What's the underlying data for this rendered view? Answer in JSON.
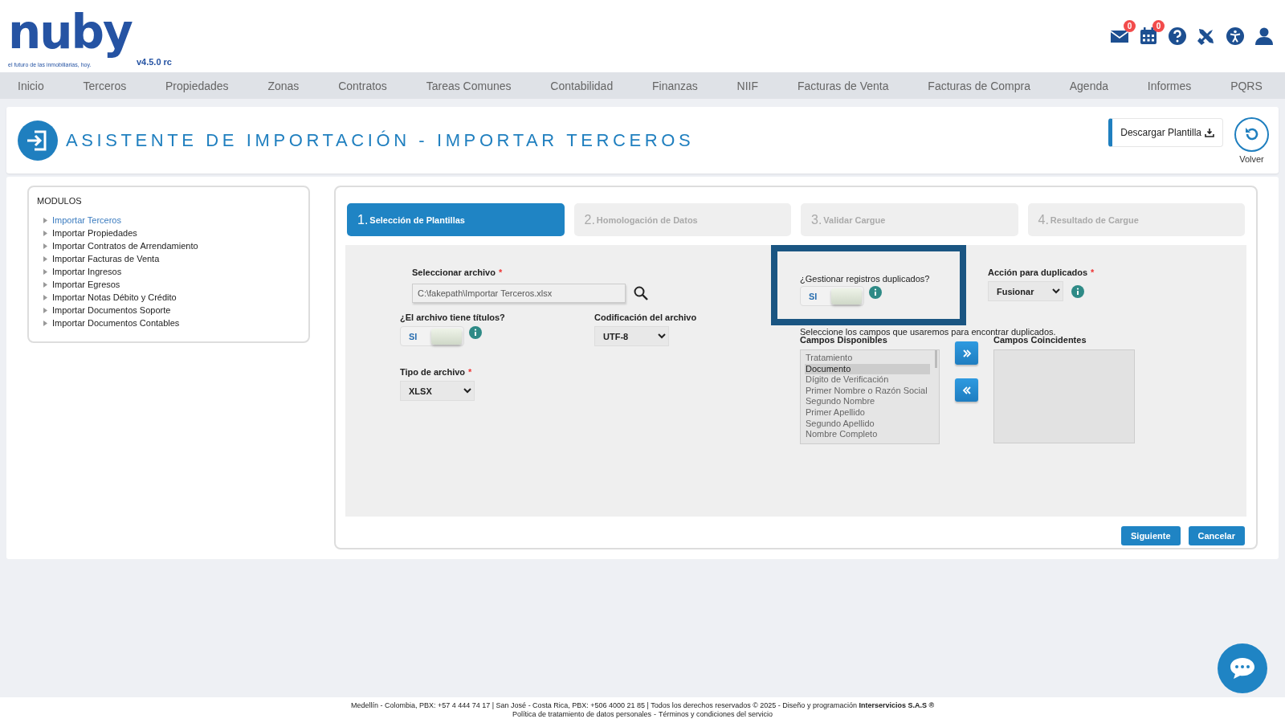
{
  "header": {
    "logo": "nuby",
    "tagline": "el futuro de las inmobiliarias, hoy.",
    "version": "v4.5.0 rc",
    "icons": [
      {
        "kind": "mail",
        "badge": "0"
      },
      {
        "kind": "calendar",
        "badge": "0"
      },
      {
        "kind": "help"
      },
      {
        "kind": "tools"
      },
      {
        "kind": "accessibility"
      },
      {
        "kind": "user"
      }
    ]
  },
  "nav": [
    "Inicio",
    "Terceros",
    "Propiedades",
    "Zonas",
    "Contratos",
    "Tareas Comunes",
    "Contabilidad",
    "Finanzas",
    "NIIF",
    "Facturas de Venta",
    "Facturas de Compra",
    "Agenda",
    "Informes",
    "PQRS"
  ],
  "page": {
    "title": "ASISTENTE DE IMPORTACIÓN - IMPORTAR TERCEROS",
    "download_button": "Descargar Plantilla",
    "back_label": "Volver"
  },
  "sidebar": {
    "title": "MODULOS",
    "items": [
      {
        "label": "Importar Terceros",
        "selected": true
      },
      {
        "label": "Importar Propiedades",
        "selected": false
      },
      {
        "label": "Importar Contratos de Arrendamiento",
        "selected": false
      },
      {
        "label": "Importar Facturas de Venta",
        "selected": false
      },
      {
        "label": "Importar Ingresos",
        "selected": false
      },
      {
        "label": "Importar Egresos",
        "selected": false
      },
      {
        "label": "Importar Notas Débito y Crédito",
        "selected": false
      },
      {
        "label": "Importar Documentos Soporte",
        "selected": false
      },
      {
        "label": "Importar Documentos Contables",
        "selected": false
      }
    ]
  },
  "steps": [
    {
      "number": "1.",
      "label": "Selección de Plantillas",
      "selected": true
    },
    {
      "number": "2.",
      "label": "Homologación de Datos",
      "selected": false
    },
    {
      "number": "3.",
      "label": "Validar Cargue",
      "selected": false
    },
    {
      "number": "4.",
      "label": "Resultado de Cargue",
      "selected": false
    }
  ],
  "form": {
    "file_label": "Seleccionar archivo",
    "file_value": "C:\\fakepath\\Importar Terceros.xlsx",
    "titles_label": "¿El archivo tiene títulos?",
    "titles_toggle": {
      "text": "SI",
      "on": true
    },
    "encoding_label": "Codificación del archivo",
    "encoding_value": "UTF-8",
    "type_label": "Tipo de archivo",
    "type_value": "XLSX",
    "required_mark": "*",
    "duplicates_label": "¿Gestionar registros duplicados?",
    "duplicates_toggle": {
      "text": "SI",
      "on": true
    },
    "action_label": "Acción para duplicados",
    "action_value": "Fusionar",
    "fields_hint": "Seleccione los campos que usaremos para encontrar duplicados.",
    "available_label": "Campos Disponibles",
    "matching_label": "Campos Coincidentes",
    "available_fields": [
      {
        "label": "Tratamiento",
        "selected": false
      },
      {
        "label": "Documento",
        "selected": true
      },
      {
        "label": "Dígito de Verificación",
        "selected": false
      },
      {
        "label": "Primer Nombre o Razón Social",
        "selected": false
      },
      {
        "label": "Segundo Nombre",
        "selected": false
      },
      {
        "label": "Primer Apellido",
        "selected": false
      },
      {
        "label": "Segundo Apellido",
        "selected": false
      },
      {
        "label": "Nombre Completo",
        "selected": false
      }
    ]
  },
  "buttons": [
    "Siguiente",
    "Cancelar"
  ],
  "footer": {
    "line": "Medellín - Colombia, PBX: +57 4 444 74 17 | San José - Costa Rica, PBX: +506 4000 21 85 | Todos los derechos reservados © 2025 - Diseño y programación **Interservicios S.A.S ®**",
    "links": [
      "Política de tratamiento de datos personales",
      "Términos y condiciones del servicio"
    ],
    "separator": "-"
  }
}
